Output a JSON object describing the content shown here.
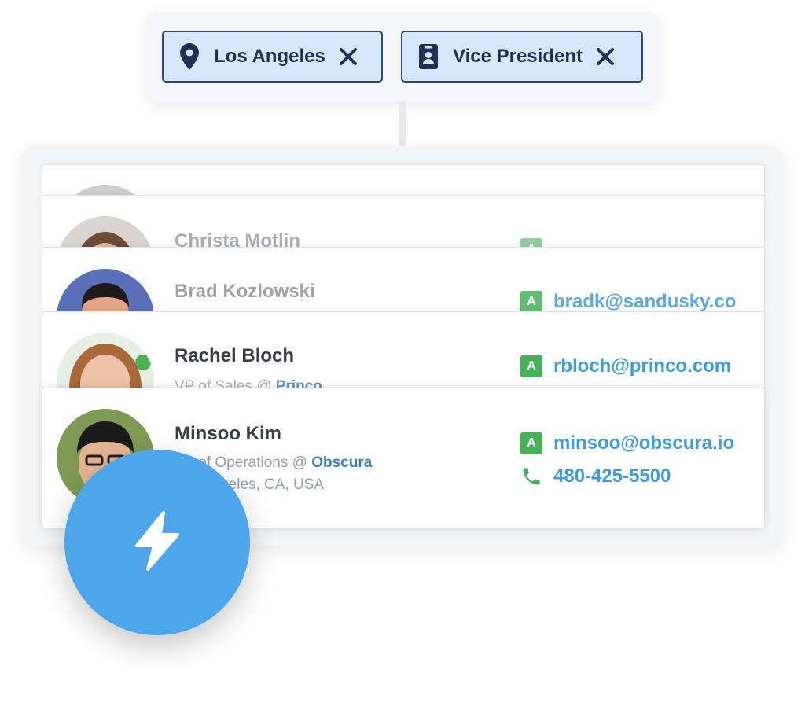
{
  "filters": [
    {
      "label": "Los Angeles",
      "icon": "map-pin-icon"
    },
    {
      "label": "Vice President",
      "icon": "id-badge-icon"
    }
  ],
  "contacts": [
    {
      "name": "Christa Motlin",
      "email_badge": "A",
      "email": ""
    },
    {
      "name": "Brad Kozlowski",
      "email_badge": "A",
      "email": "bradk@sandusky.co"
    },
    {
      "name": "Rachel Bloch",
      "title": "VP of Sales @ ",
      "company": "Princo",
      "email_badge": "A",
      "email": "rbloch@princo.com"
    },
    {
      "name": "Minsoo Kim",
      "title": "VP of Operations @ ",
      "company": "Obscura",
      "location": "Los Angeles, CA, USA",
      "email_badge": "A",
      "email": "minsoo@obscura.io",
      "phone": "480-425-5500"
    }
  ],
  "colors": {
    "chip_bg": "#d6e7fa",
    "chip_border": "#2f4a7a",
    "link_blue": "#3d9be0",
    "badge_green": "#45b25a",
    "action_button": "#4ea6ea"
  },
  "action_button": {
    "icon": "lightning-bolt-icon"
  }
}
